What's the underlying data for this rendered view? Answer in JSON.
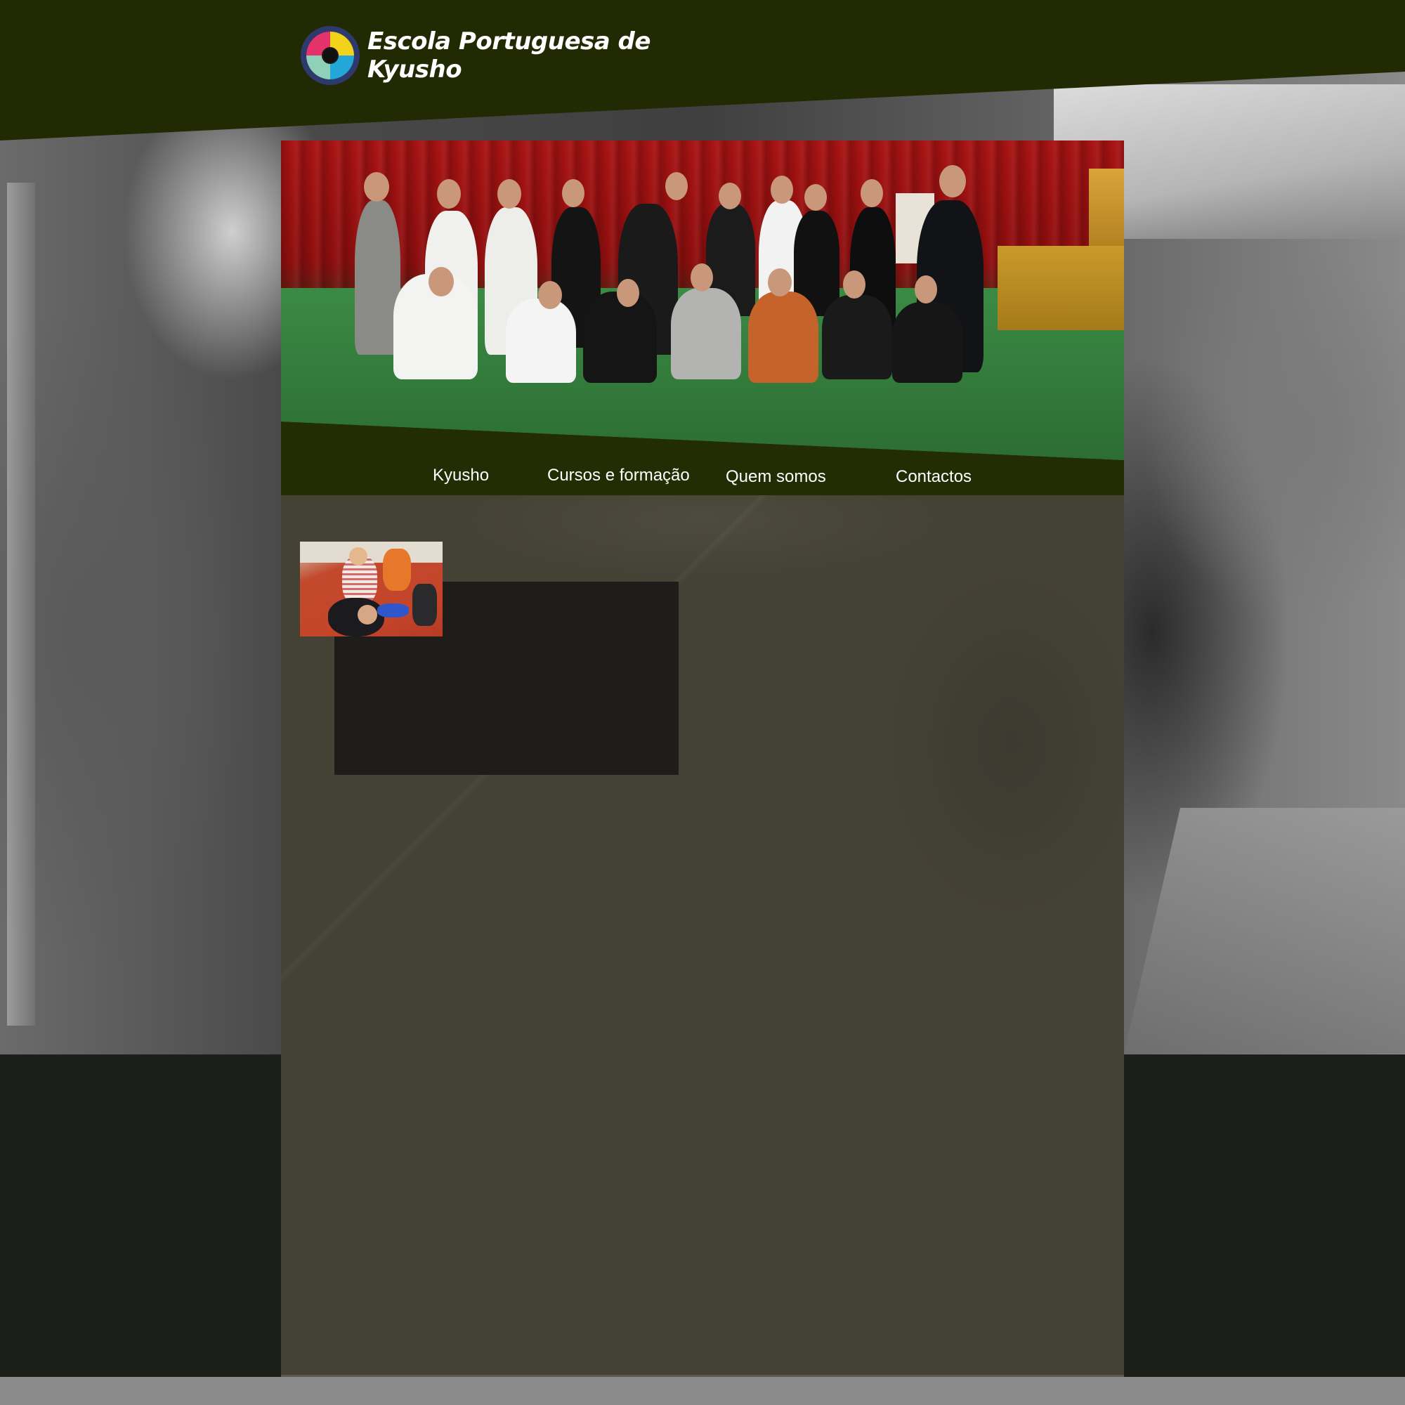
{
  "site": {
    "title_line1": "Escola Portuguesa de",
    "title_line2": "Kyusho",
    "logo_icon": "kyusho-emblem-icon"
  },
  "nav": {
    "items": [
      {
        "label": "Kyusho"
      },
      {
        "label": "Cursos e formação"
      },
      {
        "label": "Quem somos"
      },
      {
        "label": "Contactos"
      }
    ]
  },
  "colors": {
    "header": "#212a02",
    "content_bg": "#444135",
    "page_bg": "#1c1f19",
    "footer": "#8a8a8a"
  }
}
